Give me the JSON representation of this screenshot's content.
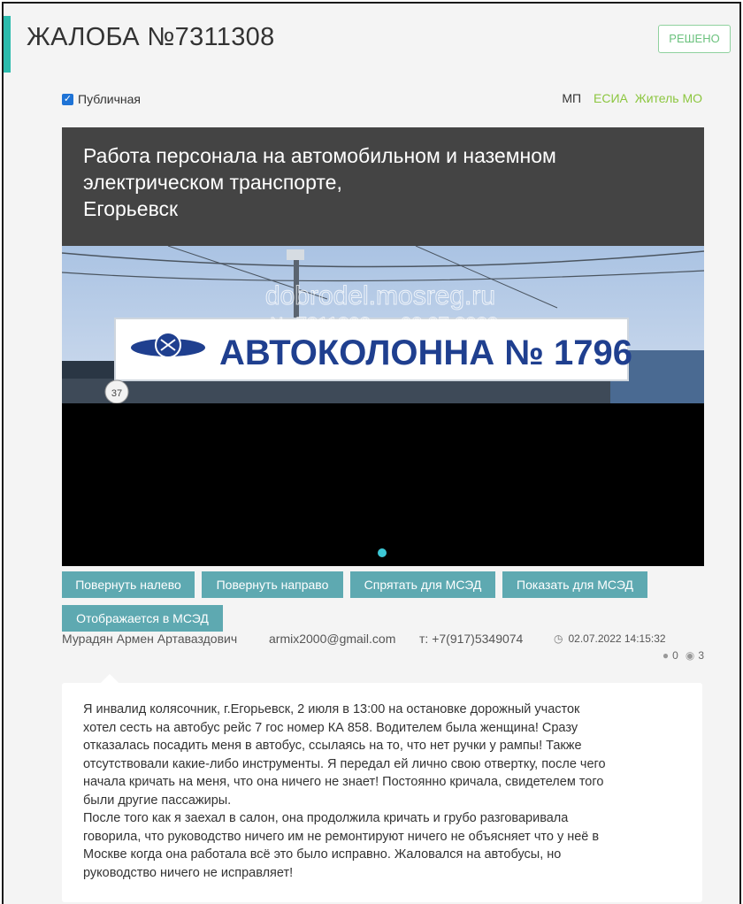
{
  "header": {
    "title": "ЖАЛОБА №7311308",
    "status": "РЕШЕНО"
  },
  "visibility": {
    "checkbox_checked": true,
    "label": "Публичная"
  },
  "tags": {
    "mp": "МП",
    "esia": "ЕСИА",
    "resident": "Житель МО"
  },
  "card": {
    "title": "Работа персонала на автомобильном и наземном\nэлектрическом транспорте,\nЕгорьевск",
    "photo_sign_text": "АВТОКОЛОННА № 1796",
    "photo_post_number": "37",
    "watermark_line1": "dobrodel.mosreg.ru",
    "watermark_line2": "№ 7311308 от 02.07.2022"
  },
  "buttons": {
    "rotate_left": "Повернуть налево",
    "rotate_right": "Повернуть направо",
    "hide_msed": "Спрятать для МСЭД",
    "show_msed": "Показать для МСЭД",
    "shown_msed": "Отображается в МСЭД"
  },
  "author": {
    "name": "Мурадян Армен Артаваздович",
    "email": "armix2000@gmail.com",
    "phone": "т: +7(917)5349074",
    "datetime": "02.07.2022 14:15:32",
    "comments": "0",
    "views": "3"
  },
  "complaint": {
    "text": "Я инвалид колясочник, г.Егорьевск, 2 июля в 13:00 на остановке дорожный участок\nхотел сесть на автобус рейс 7 гос номер КА 858. Водителем была женщина! Сразу\nотказалась посадить меня в автобус, ссылаясь на то, что нет ручки у рампы! Также\nотсутствовали какие-либо инструменты. Я передал ей лично свою отвертку, после чего\nначала кричать на меня, что она ничего не знает! Постоянно кричала, свидетелем того\nбыли другие пассажиры.\nПосле того как я заехал в салон, она продолжила кричать и грубо разговаривала\nговорила, что руководство ничего им не ремонтируют ничего не объясняет что у неё в\nМоскве когда она работала всё это было исправно. Жаловался на автобусы, но\nруководство ничего не исправляет!"
  },
  "colors": {
    "accent": "#2bbbad",
    "button": "#5ea9b1",
    "status_green": "#6cc27e",
    "tag_green": "#8cc63f"
  }
}
